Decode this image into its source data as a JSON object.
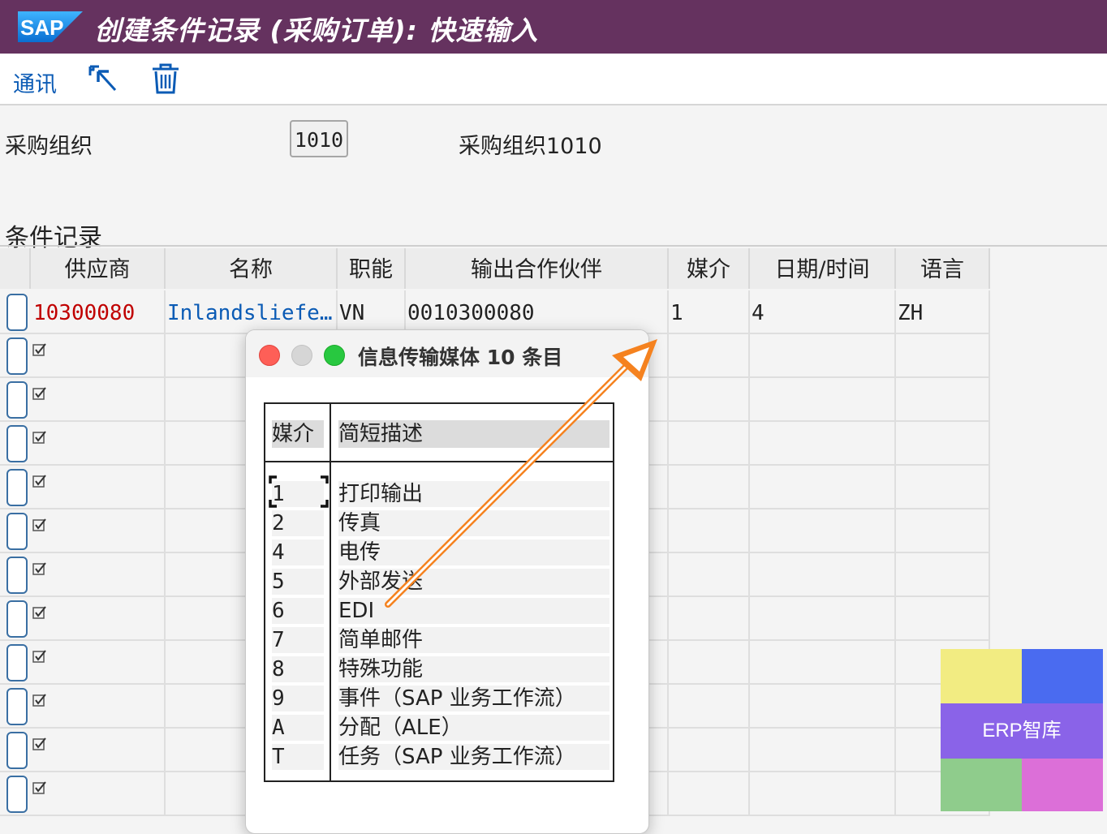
{
  "window": {
    "logo_text": "SAP",
    "title": "创建条件记录 (采购订单): 快速输入"
  },
  "toolbar": {
    "communication_label": "通讯",
    "icons": [
      "select-pointer-icon",
      "trash-icon"
    ]
  },
  "header": {
    "purch_org_label": "采购组织",
    "purch_org_value": "1010",
    "purch_org_desc": "采购组织1010"
  },
  "table": {
    "section_title": "条件记录",
    "columns": [
      "供应商",
      "名称",
      "职能",
      "输出合作伙伴",
      "媒介",
      "日期/时间",
      "语言"
    ],
    "rows": [
      {
        "vendor": "10300080",
        "name": "Inlandslieferant...",
        "function": "VN",
        "output_partner": "0010300080",
        "medium": "1",
        "datetime": "4",
        "language": "ZH"
      }
    ],
    "empty_row_count": 11
  },
  "popup": {
    "title": "信息传输媒体 10 条目",
    "col_key": "媒介",
    "col_desc": "简短描述",
    "items": [
      {
        "key": "1",
        "desc": "打印输出"
      },
      {
        "key": "2",
        "desc": "传真"
      },
      {
        "key": "4",
        "desc": "电传"
      },
      {
        "key": "5",
        "desc": "外部发送"
      },
      {
        "key": "6",
        "desc": "EDI"
      },
      {
        "key": "7",
        "desc": "简单邮件"
      },
      {
        "key": "8",
        "desc": "特殊功能"
      },
      {
        "key": "9",
        "desc": "事件（SAP 业务工作流）"
      },
      {
        "key": "A",
        "desc": "分配（ALE）"
      },
      {
        "key": "T",
        "desc": "任务（SAP 业务工作流）"
      }
    ]
  },
  "watermark": {
    "text": "ERP智库"
  },
  "colors": {
    "titlebar": "#65325f",
    "link_blue": "#0b5bb5",
    "vendor_red": "#c00000",
    "arrow_orange": "#f5821f"
  }
}
